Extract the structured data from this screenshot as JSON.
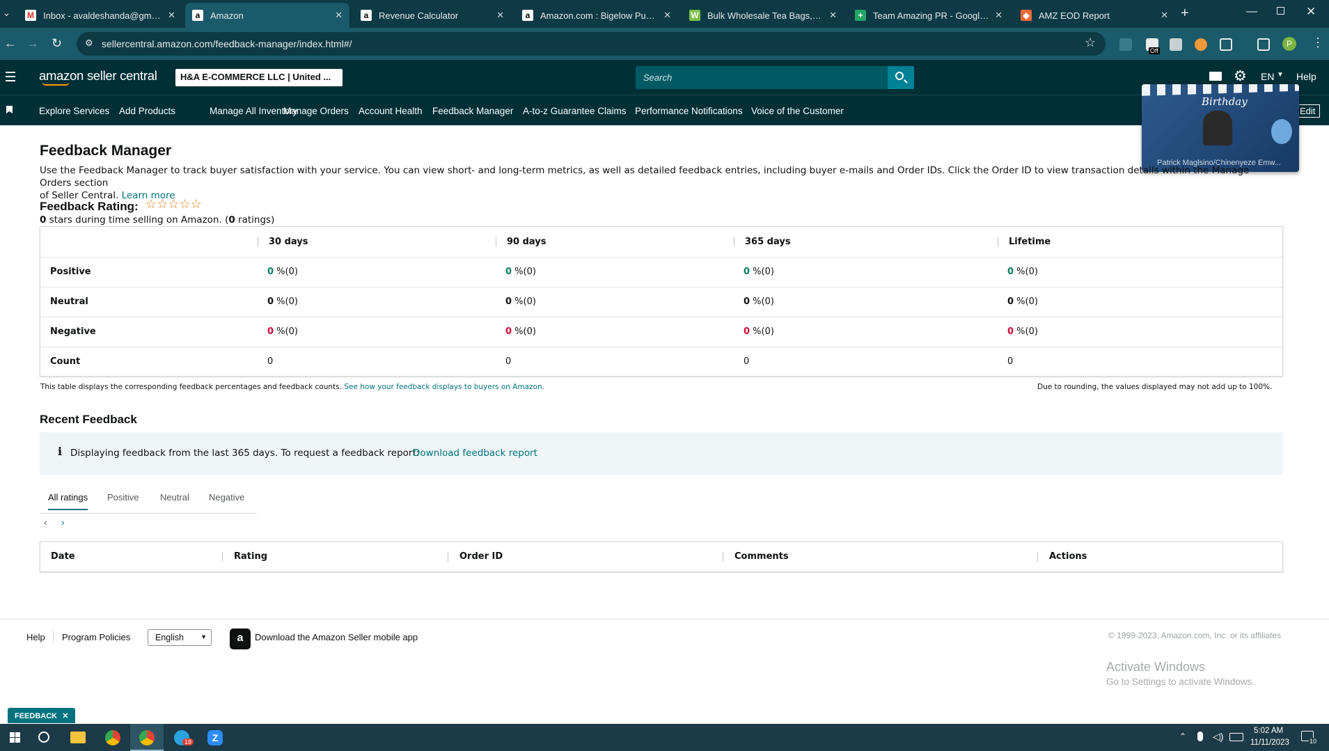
{
  "browser": {
    "tabs": [
      {
        "title": "Inbox - avaldeshanda@gmail.co",
        "favicon": "gmail-icon"
      },
      {
        "title": "Amazon",
        "favicon": "amazon-icon",
        "active": true
      },
      {
        "title": "Revenue Calculator",
        "favicon": "amazon-icon"
      },
      {
        "title": "Amazon.com : Bigelow Pumpki",
        "favicon": "amazon-icon"
      },
      {
        "title": "Bulk Wholesale Tea Bags, Sach",
        "favicon": "wholesale-icon"
      },
      {
        "title": "Team Amazing PR - Google She",
        "favicon": "sheets-icon"
      },
      {
        "title": "AMZ EOD Report",
        "favicon": "report-icon"
      }
    ],
    "url": "sellercentral.amazon.com/feedback-manager/index.html#/",
    "profile_initial": "P",
    "extension_badge": "Off"
  },
  "header": {
    "logo_text": "amazon seller central",
    "account_selector": "H&A E-COMMERCE LLC | United ...",
    "search_placeholder": "Search",
    "language": "EN",
    "help_label": "Help"
  },
  "nav": {
    "items": [
      "Explore Services",
      "Add Products",
      "Manage All Inventory",
      "Manage Orders",
      "Account Health",
      "Feedback Manager",
      "A-to-z Guarantee Claims",
      "Performance Notifications",
      "Voice of the Customer"
    ],
    "edit_label": "Edit"
  },
  "video_overlay": {
    "banner_text": "Birthday",
    "caption": "Patrick Maglsino/Chinenyeze Emw..."
  },
  "page": {
    "title": "Feedback Manager",
    "description": "Use the Feedback Manager to track buyer satisfaction with your service. You can view short- and long-term metrics, as well as detailed feedback entries, including buyer e-mails and Order IDs. Click the Order ID to view transaction details within the Manage Orders section",
    "description_cont": "of Seller Central.",
    "learn_more": "Learn more",
    "rating_label": "Feedback Rating:",
    "stars_value": 0,
    "stars_max": 5,
    "rating_stars": "0",
    "rating_text_mid": " stars during time selling on Amazon. (",
    "rating_count": "0",
    "rating_text_end": " ratings)"
  },
  "rating_table": {
    "columns": [
      "30 days",
      "90 days",
      "365 days",
      "Lifetime"
    ],
    "rows": [
      {
        "label": "Positive",
        "values": [
          [
            "0",
            " %(0)"
          ],
          [
            "0",
            " %(0)"
          ],
          [
            "0",
            " %(0)"
          ],
          [
            "0",
            " %(0)"
          ]
        ],
        "color": "#067d62"
      },
      {
        "label": "Neutral",
        "values": [
          [
            "0",
            " %(0)"
          ],
          [
            "0",
            " %(0)"
          ],
          [
            "0",
            " %(0)"
          ],
          [
            "0",
            " %(0)"
          ]
        ],
        "color": "#0f1111"
      },
      {
        "label": "Negative",
        "values": [
          [
            "0",
            " %(0)"
          ],
          [
            "0",
            " %(0)"
          ],
          [
            "0",
            " %(0)"
          ],
          [
            "0",
            " %(0)"
          ]
        ],
        "color": "#cc0c39"
      },
      {
        "label": "Count",
        "values": [
          [
            "0",
            ""
          ],
          [
            "0",
            ""
          ],
          [
            "0",
            ""
          ],
          [
            "0",
            ""
          ]
        ],
        "color": "#0f1111"
      }
    ],
    "footnote": "This table displays the corresponding feedback percentages and feedback counts.",
    "footnote_link": "See how your feedback displays to buyers on Amazon.",
    "rounding_note": "Due to rounding, the values displayed may not add up to 100%."
  },
  "recent": {
    "title": "Recent Feedback",
    "info_text": "Displaying feedback from the last 365 days. To request a feedback report:",
    "info_link": "Download feedback report",
    "tabs": [
      "All ratings",
      "Positive",
      "Neutral",
      "Negative"
    ],
    "columns": [
      "Date",
      "Rating",
      "Order ID",
      "Comments",
      "Actions"
    ]
  },
  "footer": {
    "help": "Help",
    "policies": "Program Policies",
    "language_select": "English",
    "app_text": "Download the Amazon Seller mobile app",
    "copyright": "© 1999-2023, Amazon.com, Inc. or its affiliates",
    "feedback_tab": "FEEDBACK"
  },
  "watermark": {
    "line1": "Activate Windows",
    "line2": "Go to Settings to activate Windows."
  },
  "taskbar": {
    "time": "5:02 AM",
    "date": "11/11/2023",
    "badge_count": "18",
    "notification_count": "10"
  },
  "colors": {
    "header_bg": "#002f36",
    "accent": "#00727e",
    "positive": "#067d62",
    "negative": "#cc0c39",
    "star": "#e47911"
  }
}
